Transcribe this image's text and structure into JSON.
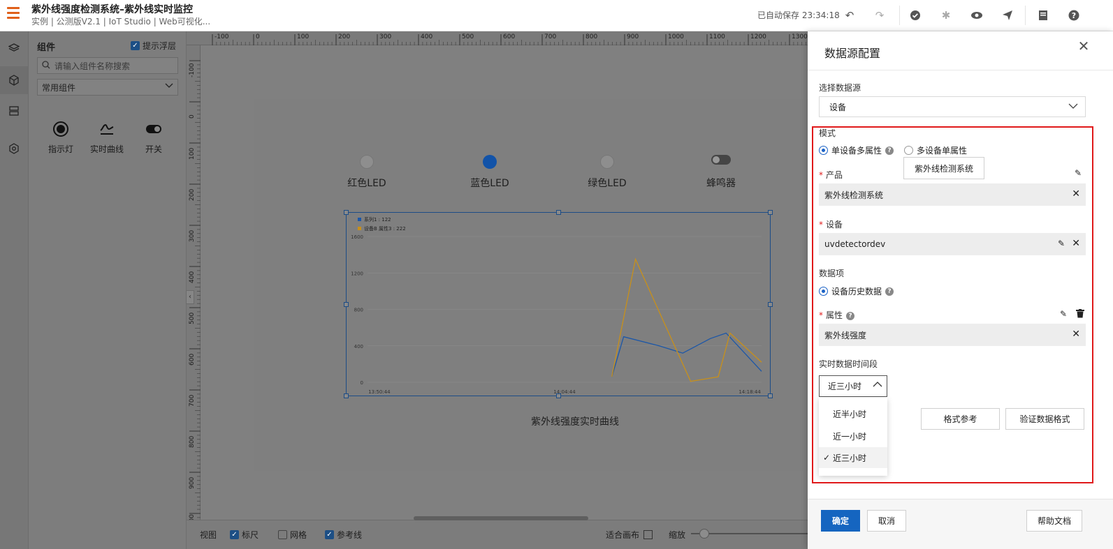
{
  "header": {
    "title": "紫外线强度检测系统–紫外线实时监控",
    "subtitle": "实例 | 公测版V2.1 | IoT Studio | Web可视化...",
    "autosave": "已自动保存 23:34:18"
  },
  "panel": {
    "title": "组件",
    "tip_float_label": "提示浮层",
    "search_placeholder": "请输入组件名称搜索",
    "category": "常用组件",
    "components": [
      {
        "label": "指示灯",
        "icon": "indicator-icon"
      },
      {
        "label": "实时曲线",
        "icon": "realtime-curve-icon"
      },
      {
        "label": "开关",
        "icon": "switch-icon"
      }
    ]
  },
  "rulers": {
    "top": [
      "-100",
      "0",
      "100",
      "200",
      "300",
      "400",
      "500",
      "600",
      "700",
      "800",
      "900",
      "1000",
      "1100",
      "1200",
      "1300"
    ],
    "left": [
      "-100",
      "0",
      "100",
      "200",
      "300",
      "400",
      "500",
      "600",
      "700",
      "800",
      "900",
      "1000"
    ]
  },
  "canvas": {
    "leds": [
      {
        "label": "红色LED",
        "color": "#8c8c8c"
      },
      {
        "label": "蓝色LED",
        "color": "#1253a8"
      },
      {
        "label": "绿色LED",
        "color": "#8c8c8c"
      },
      {
        "label": "蜂鸣器",
        "color": "#3a3a3a"
      }
    ],
    "chart_caption": "紫外线强度实时曲线"
  },
  "chart_data": {
    "type": "line",
    "title": "",
    "x": [
      "13:50:44",
      "14:04:44",
      "14:18:44"
    ],
    "ylim": [
      0,
      1600
    ],
    "yticks": [
      "1600",
      "1200",
      "800",
      "400",
      "0"
    ],
    "legend_position": "top-left",
    "series": [
      {
        "name": "系列1 : 122",
        "color": "#1c57a8",
        "points": [
          [
            0.62,
            60
          ],
          [
            0.65,
            500
          ],
          [
            0.74,
            400
          ],
          [
            0.8,
            320
          ],
          [
            0.87,
            480
          ],
          [
            0.91,
            540
          ],
          [
            1.0,
            120
          ]
        ]
      },
      {
        "name": "设备B 属性3 : 222",
        "color": "#c8901a",
        "points": [
          [
            0.62,
            60
          ],
          [
            0.68,
            1350
          ],
          [
            0.82,
            10
          ],
          [
            0.89,
            60
          ],
          [
            0.92,
            540
          ],
          [
            1.0,
            220
          ]
        ]
      }
    ]
  },
  "bottombar": {
    "view": "视图",
    "ruler": "标尺",
    "grid": "网格",
    "guides": "参考线",
    "fit": "适合画布",
    "zoom": "缩放"
  },
  "drawer": {
    "title": "数据源配置",
    "datasource_label": "选择数据源",
    "datasource_value": "设备",
    "mode_label": "模式",
    "mode_single": "单设备多属性",
    "mode_multi": "多设备单属性",
    "product_label": "产品",
    "product_tip": "紫外线检测系统",
    "product_value": "紫外线检测系统",
    "device_label": "设备",
    "device_value": "uvdetectordev",
    "dataitem_label": "数据项",
    "dataitem_value": "设备历史数据",
    "attribute_label": "属性",
    "attribute_value": "紫外线强度",
    "period_label": "实时数据时间段",
    "period_value": "近三小时",
    "period_options": [
      "近半小时",
      "近一小时",
      "近三小时"
    ],
    "format_ref": "格式参考",
    "verify_format": "验证数据格式",
    "ok": "确定",
    "cancel": "取消",
    "help_doc": "帮助文档"
  }
}
